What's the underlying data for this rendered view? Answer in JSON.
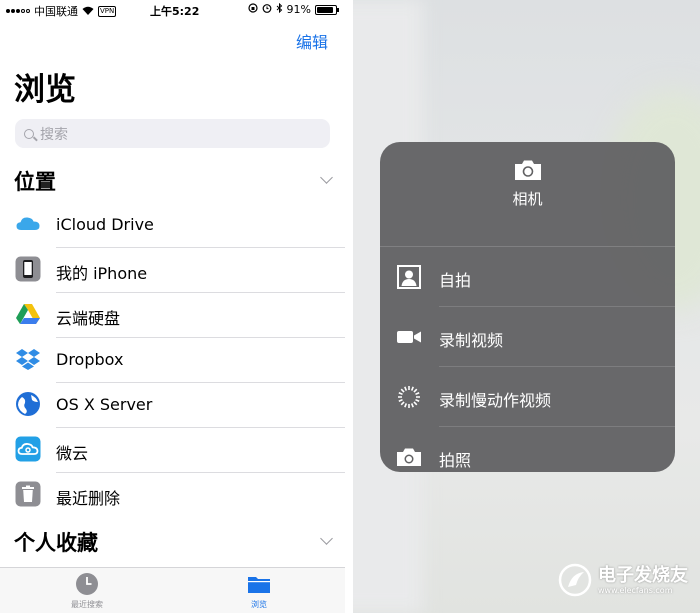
{
  "status_bar": {
    "carrier": "中国联通",
    "vpn": "VPN",
    "time": "上午5:22",
    "battery": "91%"
  },
  "nav": {
    "edit": "编辑",
    "title": "浏览"
  },
  "search": {
    "placeholder": "搜索"
  },
  "locations": {
    "header": "位置",
    "items": [
      {
        "label": "iCloud Drive",
        "icon": "icloud-icon"
      },
      {
        "label": "我的 iPhone",
        "icon": "iphone-icon"
      },
      {
        "label": "云端硬盘",
        "icon": "google-drive-icon"
      },
      {
        "label": "Dropbox",
        "icon": "dropbox-icon"
      },
      {
        "label": "OS X Server",
        "icon": "globe-icon"
      },
      {
        "label": "微云",
        "icon": "weiyun-icon"
      },
      {
        "label": "最近删除",
        "icon": "trash-icon"
      }
    ]
  },
  "favorites": {
    "header": "个人收藏"
  },
  "tabbar": {
    "recents": "最近搜索",
    "browse": "浏览",
    "active_color": "#1a73e8"
  },
  "camera_menu": {
    "app_name": "相机",
    "items": [
      {
        "label": "自拍",
        "icon": "selfie-icon"
      },
      {
        "label": "录制视频",
        "icon": "video-camera-icon"
      },
      {
        "label": "录制慢动作视频",
        "icon": "slow-motion-icon"
      },
      {
        "label": "拍照",
        "icon": "camera-icon"
      }
    ]
  },
  "watermark": {
    "name": "电子发烧友",
    "url": "www.elecfans.com"
  }
}
